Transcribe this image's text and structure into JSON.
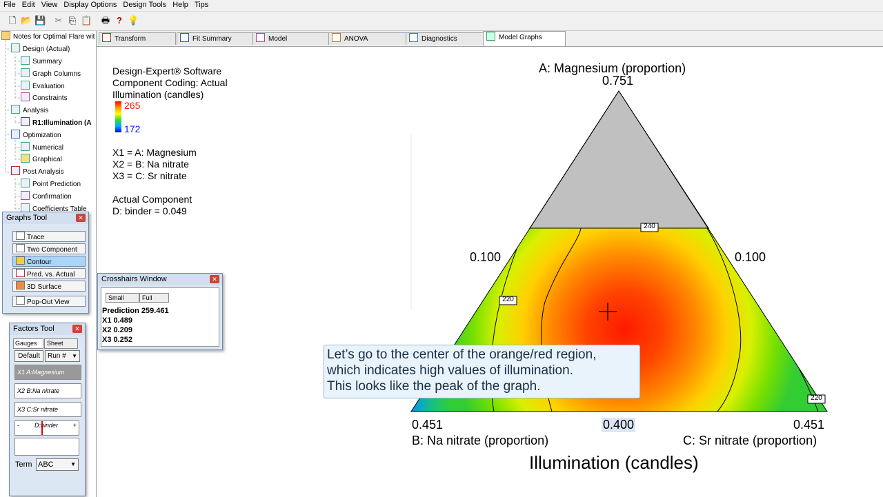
{
  "menu": [
    "File",
    "Edit",
    "View",
    "Display Options",
    "Design Tools",
    "Help",
    "Tips"
  ],
  "toolbar_icons": [
    "new-file-icon",
    "open-folder-icon",
    "save-icon",
    "cut-icon",
    "copy-icon",
    "paste-icon",
    "print-icon",
    "help-icon",
    "tip-bulb-icon"
  ],
  "toolbar_glyphs": [
    "🗋",
    "📂",
    "💾",
    "✂",
    "⎘",
    "📋",
    "🖶",
    "?",
    "💡"
  ],
  "tree": {
    "root": "Notes for Optimal Flare wit",
    "items": [
      "Design (Actual)",
      "Summary",
      "Graph Columns",
      "Evaluation",
      "Constraints",
      "Analysis",
      "R1:Illumination (A",
      "Optimization",
      "Numerical",
      "Graphical",
      "Post Analysis",
      "Point Prediction",
      "Confirmation",
      "Coefficients Table"
    ]
  },
  "tabs": [
    "Transform",
    "Fit Summary",
    "Model",
    "ANOVA",
    "Diagnostics",
    "Model Graphs"
  ],
  "info": {
    "line1": "Design-Expert® Software",
    "line2": "Component Coding: Actual",
    "line3": "Illumination (candles)",
    "legend_high": "265",
    "legend_low": "172",
    "x1": "X1 = A: Magnesium",
    "x2": "X2 = B: Na nitrate",
    "x3": "X3 = C: Sr nitrate",
    "actual_title": "Actual Component",
    "actual_value": "D: binder = 0.049"
  },
  "graphs_tool": {
    "title": "Graphs Tool",
    "buttons": [
      "Trace",
      "Two Component",
      "Contour",
      "Pred. vs. Actual",
      "3D Surface"
    ],
    "popout": "Pop-Out View",
    "active": "Contour"
  },
  "factors_tool": {
    "title": "Factors Tool",
    "tab_gauges": "Gauges",
    "tab_sheet": "Sheet",
    "default_btn": "Default",
    "run_select": "Run #",
    "factors": [
      "X1 A:Magnesium",
      "X2 B:Na nitrate",
      "X3 C:Sr nitrate"
    ],
    "binder": "D:binder",
    "minus": "-",
    "plus": "+",
    "term_label": "Term",
    "term_value": "ABC"
  },
  "crosshairs": {
    "title": "Crosshairs Window",
    "small": "Small",
    "full": "Full",
    "prediction": "Prediction 259.461",
    "x1": "X1 0.489",
    "x2": "X2 0.209",
    "x3": "X3 0.252"
  },
  "graph": {
    "top_label": "A: Magnesium (proportion)",
    "top_value": "0.751",
    "left_side": "0.100",
    "right_side": "0.100",
    "bottom_left_value": "0.451",
    "bottom_mid_value": "0.400",
    "bottom_right_value": "0.451",
    "b_label": "B: Na nitrate (proportion)",
    "c_label": "C: Sr nitrate (proportion)",
    "title": "Illumination (candles)",
    "contours": [
      "240",
      "220",
      "220"
    ]
  },
  "callout": {
    "line1": "Let’s go to the center of the orange/red region,",
    "line2": "which indicates high values of illumination.",
    "line3": "This looks like the peak of the graph."
  },
  "colors": {
    "high": "#ff1a00",
    "low": "#0010ff",
    "gray_region": "#c0c0c0",
    "callout_bg": "#e8f3fb"
  }
}
